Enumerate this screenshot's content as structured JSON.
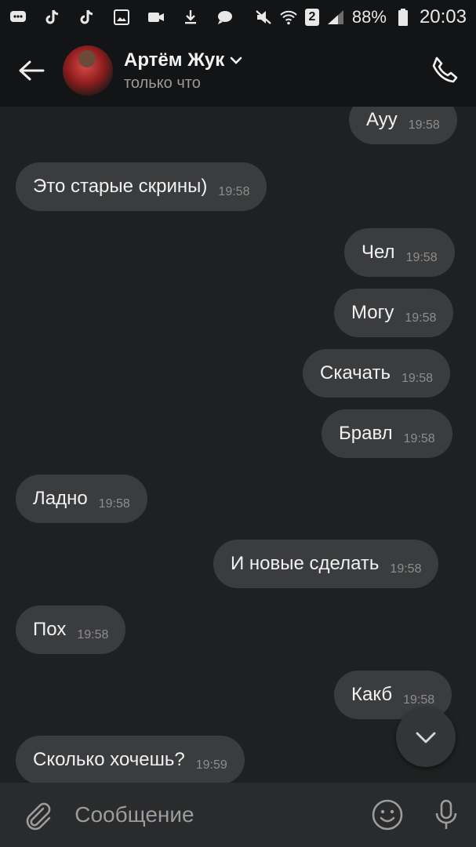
{
  "status_bar": {
    "time": "20:03",
    "battery": "88%",
    "sim_badge": "2",
    "icons": [
      "messages-icon",
      "tiktok-icon",
      "tiktok-icon",
      "gallery-icon",
      "video-icon",
      "download-icon",
      "chat-icon",
      "mute-icon",
      "wifi-icon",
      "sim-icon",
      "signal-icon",
      "battery-icon"
    ]
  },
  "header": {
    "contact_name": "Артём Жук",
    "contact_status": "только что"
  },
  "messages": [
    {
      "side": "out",
      "text": "Ауу",
      "time": "19:58"
    },
    {
      "side": "in",
      "text": "Это старые скрины)",
      "time": "19:58"
    },
    {
      "side": "out",
      "text": "Чел",
      "time": "19:58"
    },
    {
      "side": "out",
      "text": "Могу",
      "time": "19:58"
    },
    {
      "side": "out",
      "text": "Скачать",
      "time": "19:58"
    },
    {
      "side": "out",
      "text": "Бравл",
      "time": "19:58"
    },
    {
      "side": "in",
      "text": "Ладно",
      "time": "19:58"
    },
    {
      "side": "out",
      "text": "И новые сделать",
      "time": "19:58"
    },
    {
      "side": "in",
      "text": "Пох",
      "time": "19:58"
    },
    {
      "side": "out",
      "text": "Какб",
      "time": "19:58"
    },
    {
      "side": "in",
      "text": "Сколько хочешь?",
      "time": "19:59"
    }
  ],
  "composer": {
    "placeholder": "Сообщение"
  },
  "colors": {
    "background": "#1f2021",
    "bubble": "#3b3c3e",
    "bar": "#131415"
  }
}
